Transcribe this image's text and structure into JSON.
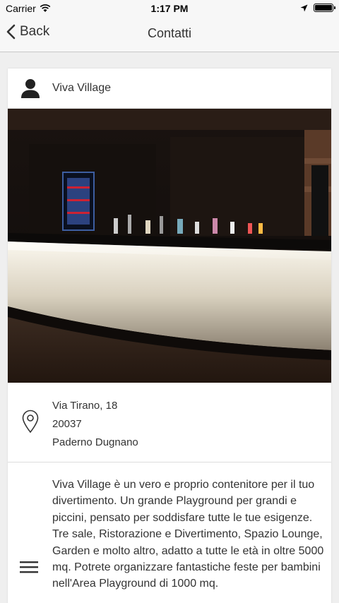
{
  "status_bar": {
    "carrier": "Carrier",
    "time": "1:17 PM"
  },
  "nav": {
    "back_label": "Back",
    "title": "Contatti"
  },
  "contact": {
    "name": "Viva Village",
    "address": {
      "street": "Via Tirano, 18",
      "postal_code": "20037",
      "city": "Paderno Dugnano"
    },
    "description": "Viva Village è un vero e proprio contenitore per il tuo divertimento. Un grande Playground per grandi e piccini, pensato per soddisfare tutte le tue esigenze. Tre sale, Ristorazione e Divertimento, Spazio Lounge, Garden e molto altro, adatto a tutte le età in oltre 5000 mq. Potrete organizzare fantastiche feste per bambini nell'Area Playground di 1000 mq."
  },
  "icons": {
    "wifi": "wifi-icon",
    "location_arrow": "location-arrow-icon",
    "battery": "battery-icon",
    "back": "chevron-left-icon",
    "person": "person-icon",
    "pin": "map-pin-icon",
    "menu": "menu-lines-icon"
  },
  "colors": {
    "background": "#efefef",
    "card": "#ffffff",
    "text": "#333333",
    "bar": "#f7f7f7"
  }
}
